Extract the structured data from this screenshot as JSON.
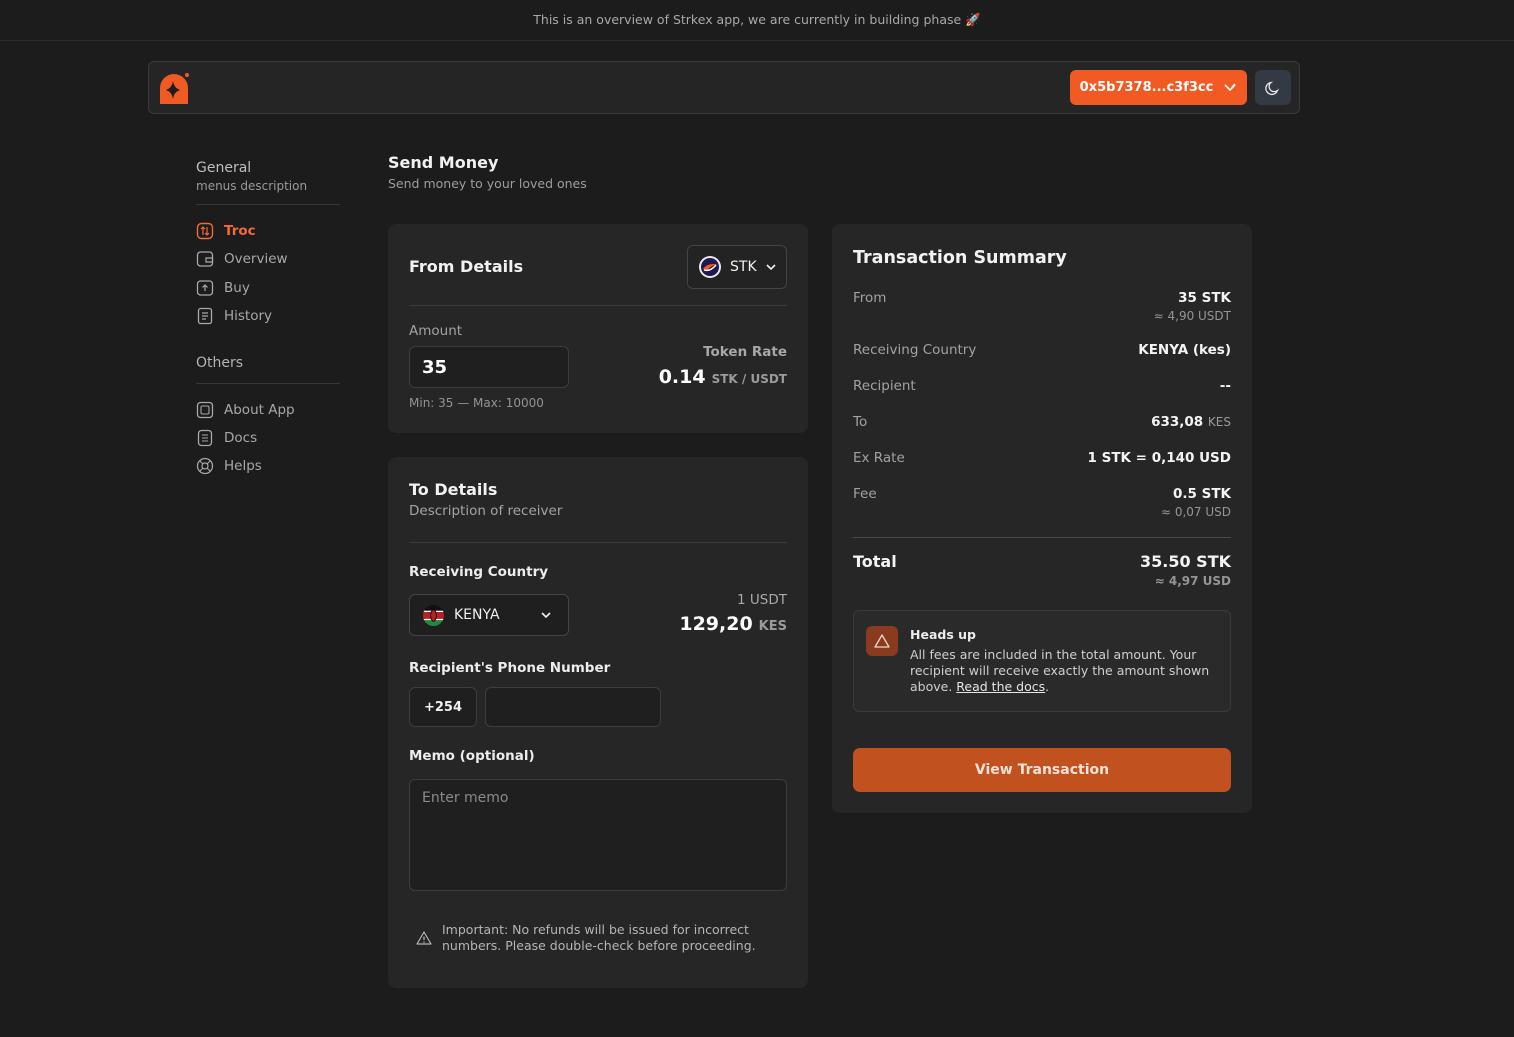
{
  "banner": {
    "text": "This is an overview of Strkex app, we are currently in building phase 🚀"
  },
  "header": {
    "wallet_address": "0x5b7378...c3f3cc"
  },
  "sidebar": {
    "general_title": "General",
    "general_desc": "menus description",
    "items": [
      {
        "label": "Troc",
        "icon": "swap-icon",
        "active": true
      },
      {
        "label": "Overview",
        "icon": "wallet-icon"
      },
      {
        "label": "Buy",
        "icon": "buy-icon"
      },
      {
        "label": "History",
        "icon": "history-icon"
      }
    ],
    "others_title": "Others",
    "others": [
      {
        "label": "About App",
        "icon": "about-icon"
      },
      {
        "label": "Docs",
        "icon": "docs-icon"
      },
      {
        "label": "Helps",
        "icon": "help-icon"
      }
    ]
  },
  "page": {
    "title": "Send Money",
    "subtitle": "Send money to your loved ones"
  },
  "from": {
    "title": "From Details",
    "token": "STK",
    "amount_label": "Amount",
    "amount_value": "35",
    "limits": "Min: 35 — Max: 10000",
    "rate_label": "Token Rate",
    "rate_value": "0.14",
    "rate_unit": "STK / USDT"
  },
  "to": {
    "title": "To Details",
    "subtitle": "Description of receiver",
    "country_label": "Receiving Country",
    "country_value": "KENYA",
    "conv_label": "1 USDT",
    "conv_value": "129,20",
    "conv_unit": "KES",
    "phone_label": "Recipient's Phone Number",
    "phone_prefix": "+254",
    "phone_value": "",
    "memo_label": "Memo (optional)",
    "memo_placeholder": "Enter memo",
    "warning": "Important: No refunds will be issued for incorrect numbers. Please double-check before proceeding."
  },
  "summary": {
    "title": "Transaction Summary",
    "from_label": "From",
    "from_value": "35 STK",
    "from_sub": "≈ 4,90 USDT",
    "country_label": "Receiving Country",
    "country_value": "KENYA (kes)",
    "recipient_label": "Recipient",
    "recipient_value": "--",
    "to_label": "To",
    "to_value": "633,08",
    "to_unit": "KES",
    "rate_label": "Ex Rate",
    "rate_value": "1 STK = 0,140 USD",
    "fee_label": "Fee",
    "fee_value": "0.5 STK",
    "fee_sub": "≈ 0,07 USD",
    "total_label": "Total",
    "total_value": "35.50 STK",
    "total_sub": "≈ 4,97 USD",
    "heads_up_title": "Heads up",
    "heads_up_text": "All fees are included in the total amount. Your recipient will receive exactly the amount shown above.",
    "heads_up_link": "Read the docs",
    "button": "View Transaction"
  },
  "colors": {
    "accent": "#f15a22",
    "button": "#c1511f",
    "background": "#1c1c1c",
    "card": "#262626"
  }
}
